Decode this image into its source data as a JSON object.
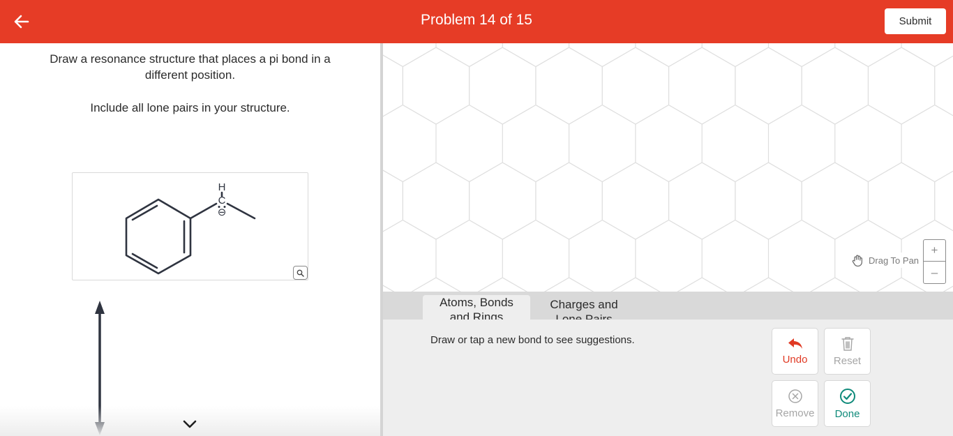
{
  "header": {
    "title": "Problem 14 of 15",
    "submit_label": "Submit",
    "accent_color": "#e63c26"
  },
  "question": {
    "line1": "Draw a resonance structure that places a pi bond in a",
    "line2": "different position.",
    "line3": "Include all lone pairs in your structure."
  },
  "molecule": {
    "atom_top": "H",
    "atom_mid": "C",
    "charge_symbol": "⊖"
  },
  "canvas": {
    "drag_hint": "Drag To Pan",
    "zoom_in": "+",
    "zoom_out": "–"
  },
  "tabs": [
    {
      "line1": "Atoms, Bonds",
      "line2": "and Rings",
      "active": true
    },
    {
      "line1": "Charges and",
      "line2": "Lone Pairs",
      "active": false
    }
  ],
  "toolbar": {
    "hint": "Draw or tap a new bond to see suggestions.",
    "undo_label": "Undo",
    "reset_label": "Reset",
    "remove_label": "Remove",
    "done_label": "Done"
  },
  "icons": [
    "back-arrow-icon",
    "magnifier-icon",
    "hand-icon",
    "undo-icon",
    "trash-icon",
    "remove-circle-icon",
    "check-circle-icon",
    "chevron-down-icon"
  ]
}
